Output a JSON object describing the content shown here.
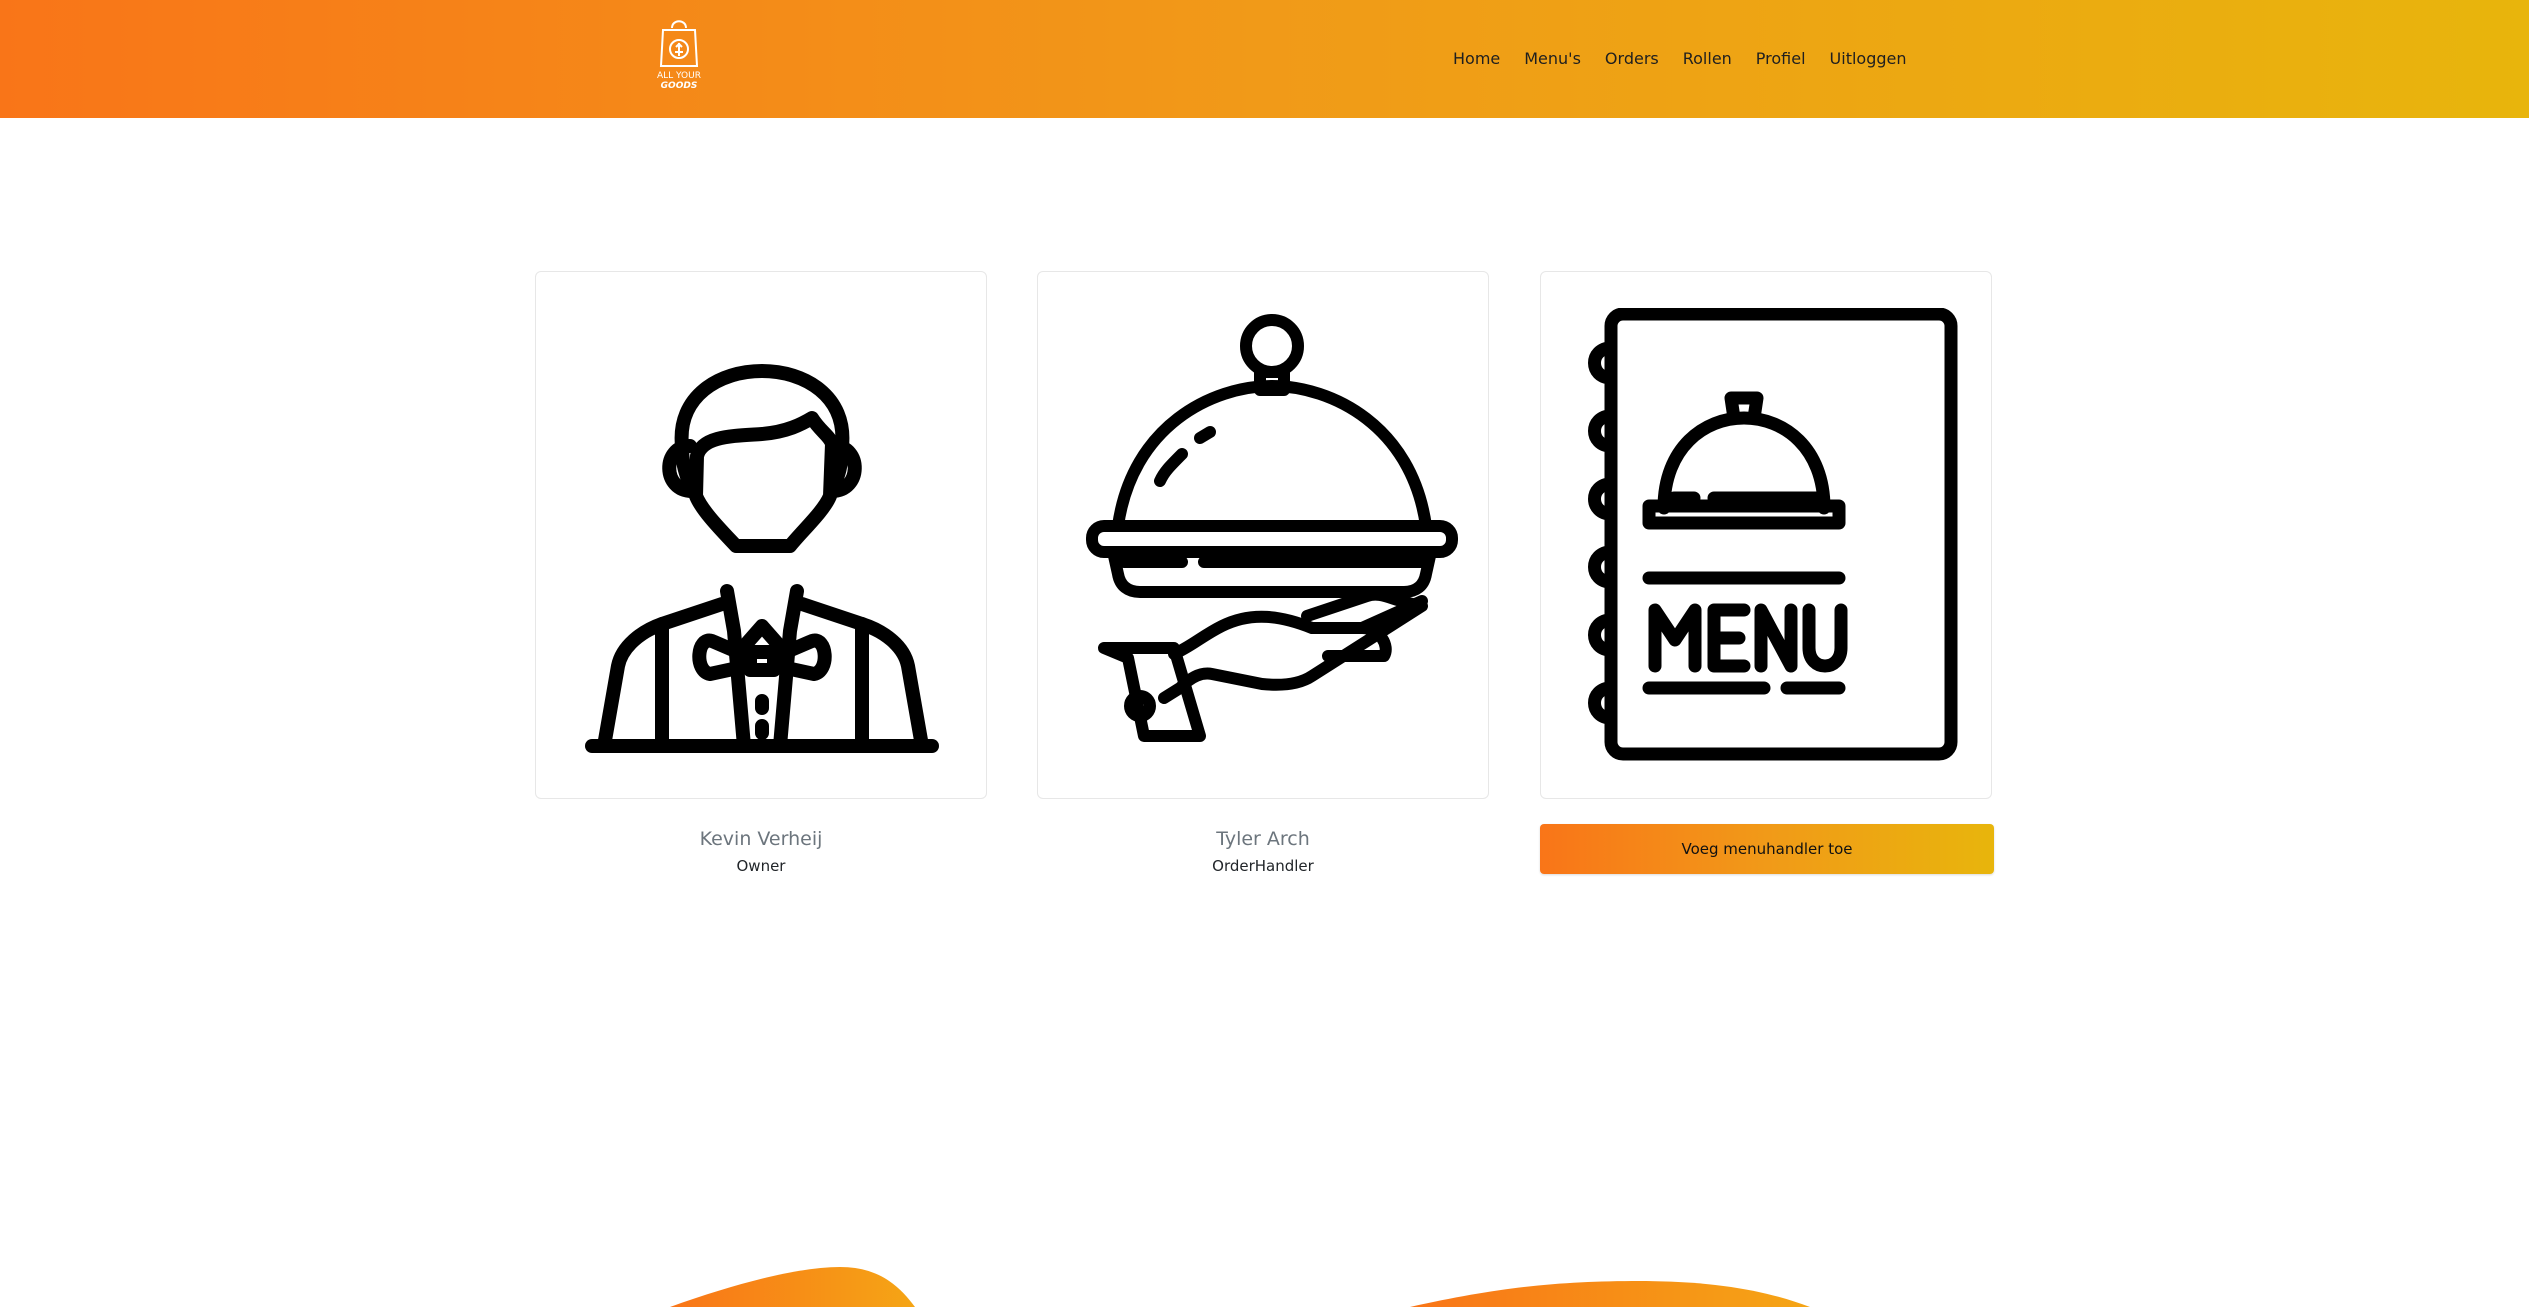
{
  "header": {
    "logo": {
      "line1": "ALL YOUR",
      "line2": "GOODS"
    },
    "nav": [
      {
        "label": "Home"
      },
      {
        "label": "Menu's"
      },
      {
        "label": "Orders"
      },
      {
        "label": "Rollen"
      },
      {
        "label": "Profiel"
      },
      {
        "label": "Uitloggen"
      }
    ]
  },
  "cards": [
    {
      "icon": "waiter-icon",
      "name": "Kevin Verheij",
      "role": "Owner"
    },
    {
      "icon": "serving-cloche-icon",
      "name": "Tyler Arch",
      "role": "OrderHandler"
    },
    {
      "icon": "menu-book-icon"
    }
  ],
  "actions": {
    "add_menuhandler": "Voeg menuhandler toe"
  },
  "colors": {
    "gradient_start": "#f97518",
    "gradient_end": "#e8b50c"
  }
}
